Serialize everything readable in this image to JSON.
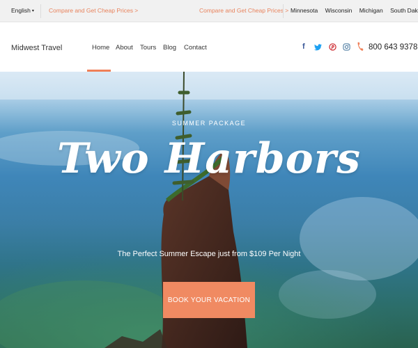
{
  "topbar": {
    "language": "English",
    "promo_left": "Compare and Get Cheap Prices  >",
    "promo_right": "Compare and Get Cheap Prices  >",
    "states": [
      "Minnesota",
      "Wisconsin",
      "Michigan",
      "South Dakota"
    ]
  },
  "nav": {
    "brand": "Midwest Travel",
    "items": [
      "Home",
      "About",
      "Tours",
      "Blog",
      "Contact"
    ],
    "active_item": "Home",
    "phone": "800 643 9378",
    "social_icons": [
      "facebook-icon",
      "twitter-icon",
      "pinterest-icon",
      "instagram-icon"
    ]
  },
  "hero": {
    "kicker": "SUMMER PACKAGE",
    "title": "Two Harbors",
    "tagline": "The Perfect Summer Escape just from $109 Per Night",
    "cta_label": "BOOK YOUR VACATION"
  },
  "colors": {
    "accent": "#f08a62",
    "promo_text": "#e8825c",
    "facebook": "#3b5998",
    "twitter": "#1da1f2",
    "pinterest": "#cb2027",
    "instagram": "#517fa4"
  }
}
